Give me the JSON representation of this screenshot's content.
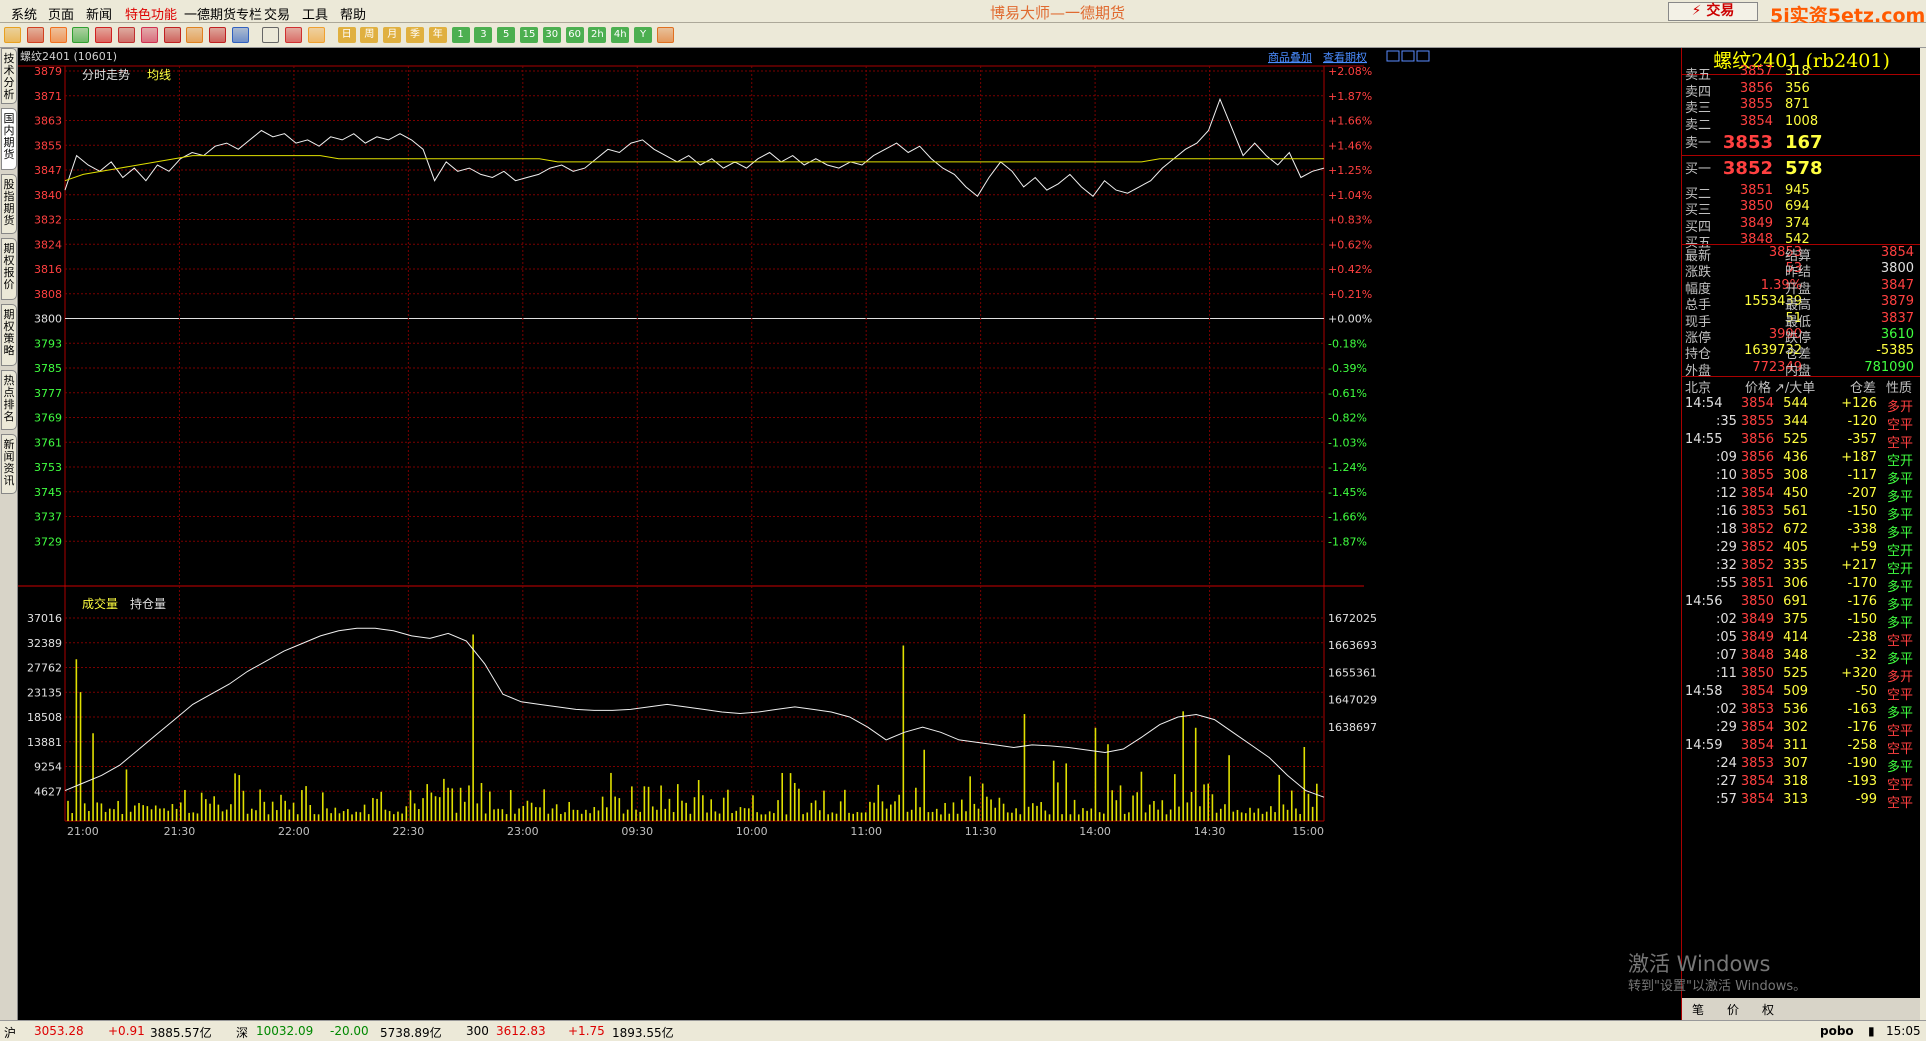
{
  "menu": {
    "items": [
      "系统",
      "页面",
      "新闻",
      "特色功能",
      "一德期货专栏",
      "交易",
      "工具",
      "帮助"
    ],
    "app_title": "博易大师—一德期货",
    "trade_button": "⚡ 交易",
    "watermark": "5i实资5etz.com"
  },
  "toolbar": {
    "buttons": [
      "back",
      "home",
      "f10",
      "refresh",
      "sync",
      "search",
      "zoom",
      "draw",
      "fill",
      "bulb",
      "新",
      "table",
      "trend",
      "dk",
      "日",
      "周",
      "月",
      "季",
      "年",
      "1",
      "3",
      "5",
      "15",
      "30",
      "60",
      "2h",
      "4h",
      "Y",
      "calc"
    ]
  },
  "left_tabs": {
    "items": [
      "技术分析",
      "国内期货",
      "股指期货",
      "期权报价",
      "期权策略",
      "热点排名",
      "新闻资讯"
    ],
    "active": 1
  },
  "chart": {
    "contract_label": "螺纹2401 (10601)",
    "link_overlay": "商品叠加",
    "link_options": "查看期权",
    "legend_price": "分时走势",
    "legend_avg": "均线",
    "legend_vol": "成交量",
    "legend_oi": "持仓量"
  },
  "chart_data": {
    "type": "line",
    "price_axis_left": [
      "3879",
      "3871",
      "3863",
      "3855",
      "3847",
      "3840",
      "3832",
      "3824",
      "3816",
      "3808",
      "3800",
      "3793",
      "3785",
      "3777",
      "3769",
      "3761",
      "3753",
      "3745",
      "3737",
      "3729"
    ],
    "price_axis_right": [
      "+2.08%",
      "+1.87%",
      "+1.66%",
      "+1.46%",
      "+1.25%",
      "+1.04%",
      "+0.83%",
      "+0.62%",
      "+0.42%",
      "+0.21%",
      "+0.00%",
      "-0.18%",
      "-0.39%",
      "-0.61%",
      "-0.82%",
      "-1.03%",
      "-1.24%",
      "-1.45%",
      "-1.66%",
      "-1.87%"
    ],
    "vol_axis_left": [
      "37016",
      "32389",
      "27762",
      "23135",
      "18508",
      "13881",
      "9254",
      "4627"
    ],
    "oi_axis_right": [
      "1672025",
      "1663693",
      "1655361",
      "1647029",
      "1638697"
    ],
    "time_labels": [
      "21:00",
      "21:30",
      "22:00",
      "22:30",
      "23:00",
      "09:30",
      "10:00",
      "11:00",
      "11:30",
      "14:00",
      "14:30",
      "15:00"
    ],
    "price_range": [
      3725,
      3883
    ],
    "base_price": 3800,
    "price_series": [
      3845,
      3856,
      3853,
      3851,
      3854,
      3849,
      3852,
      3848,
      3853,
      3851,
      3855,
      3857,
      3856,
      3859,
      3860,
      3858,
      3861,
      3864,
      3862,
      3863,
      3860,
      3861,
      3859,
      3862,
      3861,
      3863,
      3860,
      3862,
      3861,
      3863,
      3861,
      3858,
      3848,
      3854,
      3851,
      3852,
      3850,
      3849,
      3851,
      3848,
      3849,
      3850,
      3852,
      3853,
      3851,
      3852,
      3855,
      3858,
      3857,
      3860,
      3861,
      3858,
      3856,
      3854,
      3856,
      3853,
      3855,
      3852,
      3854,
      3852,
      3855,
      3857,
      3854,
      3856,
      3853,
      3855,
      3853,
      3852,
      3854,
      3853,
      3856,
      3858,
      3860,
      3857,
      3859,
      3855,
      3852,
      3850,
      3846,
      3843,
      3849,
      3854,
      3851,
      3846,
      3849,
      3845,
      3847,
      3850,
      3846,
      3843,
      3848,
      3845,
      3844,
      3846,
      3848,
      3852,
      3855,
      3858,
      3860,
      3864,
      3874,
      3865,
      3856,
      3860,
      3856,
      3853,
      3857,
      3849,
      3851,
      3852
    ],
    "avg_series": [
      3848,
      3850,
      3851,
      3852,
      3853,
      3854,
      3855,
      3856,
      3856,
      3856,
      3856,
      3856,
      3856,
      3856,
      3856,
      3855,
      3855,
      3855,
      3855,
      3855,
      3855,
      3855,
      3855,
      3855,
      3855,
      3855,
      3855,
      3854,
      3854,
      3854,
      3854,
      3854,
      3854,
      3854,
      3854,
      3854,
      3854,
      3854,
      3854,
      3854,
      3854,
      3854,
      3854,
      3854,
      3854,
      3854,
      3854,
      3854,
      3854,
      3854,
      3854,
      3854,
      3854,
      3854,
      3854,
      3854,
      3854,
      3854,
      3854,
      3854,
      3855,
      3855,
      3855,
      3855,
      3855,
      3855,
      3855,
      3855,
      3855,
      3855
    ],
    "oi_series": [
      1640000,
      1641500,
      1643000,
      1645000,
      1648000,
      1651000,
      1654000,
      1657000,
      1659000,
      1661000,
      1663500,
      1665500,
      1667500,
      1669000,
      1670500,
      1671500,
      1672025,
      1672000,
      1671500,
      1670500,
      1670000,
      1671000,
      1669500,
      1665000,
      1659000,
      1657500,
      1657000,
      1656500,
      1656000,
      1655800,
      1655800,
      1656000,
      1656500,
      1657000,
      1656500,
      1656000,
      1655500,
      1655200,
      1655500,
      1656000,
      1656500,
      1656000,
      1655500,
      1654500,
      1652500,
      1650000,
      1651500,
      1652500,
      1651500,
      1650000,
      1649500,
      1649000,
      1648500,
      1649000,
      1648800,
      1648500,
      1648000,
      1647500,
      1648200,
      1650500,
      1653000,
      1654500,
      1655000,
      1654000,
      1651500,
      1649000,
      1646500,
      1643000,
      1640000,
      1638697
    ],
    "oi_range": [
      1634000,
      1676000
    ],
    "vol_max": 37016,
    "vol_spikes": [
      {
        "i": 2,
        "v": 29500
      },
      {
        "i": 3,
        "v": 23500
      },
      {
        "i": 6,
        "v": 16000
      },
      {
        "i": 97,
        "v": 34000
      },
      {
        "i": 200,
        "v": 32000
      },
      {
        "i": 267,
        "v": 20000
      },
      {
        "i": 236,
        "v": 11000
      },
      {
        "i": 205,
        "v": 13000
      },
      {
        "i": 239,
        "v": 10500
      },
      {
        "i": 229,
        "v": 19500
      },
      {
        "i": 246,
        "v": 17000
      },
      {
        "i": 249,
        "v": 14000
      },
      {
        "i": 270,
        "v": 17000
      },
      {
        "i": 278,
        "v": 12000
      },
      {
        "i": 296,
        "v": 13500
      }
    ]
  },
  "quote": {
    "title": "螺纹2401 (rb2401)",
    "asks": [
      {
        "label": "卖五",
        "price": "3857",
        "vol": "318"
      },
      {
        "label": "卖四",
        "price": "3856",
        "vol": "356"
      },
      {
        "label": "卖三",
        "price": "3855",
        "vol": "871"
      },
      {
        "label": "卖二",
        "price": "3854",
        "vol": "1008"
      },
      {
        "label": "卖一",
        "price": "3853",
        "vol": "167"
      }
    ],
    "bids": [
      {
        "label": "买一",
        "price": "3852",
        "vol": "578"
      },
      {
        "label": "买二",
        "price": "3851",
        "vol": "945"
      },
      {
        "label": "买三",
        "price": "3850",
        "vol": "694"
      },
      {
        "label": "买四",
        "price": "3849",
        "vol": "374"
      },
      {
        "label": "买五",
        "price": "3848",
        "vol": "542"
      }
    ],
    "stats": [
      {
        "l1": "最新",
        "v1": "3853",
        "c1": "red",
        "l2": "结算",
        "v2": "3854",
        "c2": "red"
      },
      {
        "l1": "涨跌",
        "v1": "53",
        "c1": "red",
        "l2": "昨结",
        "v2": "3800",
        "c2": "wht"
      },
      {
        "l1": "幅度",
        "v1": "1.39%",
        "c1": "red",
        "l2": "开盘",
        "v2": "3847",
        "c2": "red"
      },
      {
        "l1": "总手",
        "v1": "1553439",
        "c1": "yel",
        "l2": "最高",
        "v2": "3879",
        "c2": "red"
      },
      {
        "l1": "现手",
        "v1": "51",
        "c1": "yel",
        "l2": "最低",
        "v2": "3837",
        "c2": "red"
      },
      {
        "l1": "涨停",
        "v1": "3990",
        "c1": "red",
        "l2": "跌停",
        "v2": "3610",
        "c2": "grn"
      },
      {
        "l1": "持仓",
        "v1": "1639732",
        "c1": "yel",
        "l2": "仓差",
        "v2": "-5385",
        "c2": "yel"
      },
      {
        "l1": "外盘",
        "v1": "772349",
        "c1": "red",
        "l2": "内盘",
        "v2": "781090",
        "c2": "grn"
      }
    ],
    "ticks_header": {
      "time": "北京",
      "price": "价格",
      "vol": "↗/大单",
      "diff": "仓差",
      "nature": "性质"
    },
    "ticks": [
      {
        "t": "14:54",
        "big": true,
        "p": "3854",
        "v": "544",
        "d": "+126",
        "n": "多开",
        "nc": "red"
      },
      {
        "t": ":35",
        "big": false,
        "p": "3855",
        "v": "344",
        "d": "-120",
        "n": "空平",
        "nc": "red"
      },
      {
        "t": "14:55",
        "big": true,
        "p": "3856",
        "v": "525",
        "d": "-357",
        "n": "空平",
        "nc": "red"
      },
      {
        "t": ":09",
        "big": false,
        "p": "3856",
        "v": "436",
        "d": "+187",
        "n": "空开",
        "nc": "grn"
      },
      {
        "t": ":10",
        "big": false,
        "p": "3855",
        "v": "308",
        "d": "-117",
        "n": "多平",
        "nc": "grn"
      },
      {
        "t": ":12",
        "big": false,
        "p": "3854",
        "v": "450",
        "d": "-207",
        "n": "多平",
        "nc": "grn"
      },
      {
        "t": ":16",
        "big": false,
        "p": "3853",
        "v": "561",
        "d": "-150",
        "n": "多平",
        "nc": "grn"
      },
      {
        "t": ":18",
        "big": false,
        "p": "3852",
        "v": "672",
        "d": "-338",
        "n": "多平",
        "nc": "grn"
      },
      {
        "t": ":29",
        "big": false,
        "p": "3852",
        "v": "405",
        "d": "+59",
        "n": "空开",
        "nc": "grn"
      },
      {
        "t": ":32",
        "big": false,
        "p": "3852",
        "v": "335",
        "d": "+217",
        "n": "空开",
        "nc": "grn"
      },
      {
        "t": ":55",
        "big": false,
        "p": "3851",
        "v": "306",
        "d": "-170",
        "n": "多平",
        "nc": "grn"
      },
      {
        "t": "14:56",
        "big": true,
        "p": "3850",
        "v": "691",
        "d": "-176",
        "n": "多平",
        "nc": "grn"
      },
      {
        "t": ":02",
        "big": false,
        "p": "3849",
        "v": "375",
        "d": "-150",
        "n": "多平",
        "nc": "grn"
      },
      {
        "t": ":05",
        "big": false,
        "p": "3849",
        "v": "414",
        "d": "-238",
        "n": "空平",
        "nc": "red"
      },
      {
        "t": ":07",
        "big": false,
        "p": "3848",
        "v": "348",
        "d": "-32",
        "n": "多平",
        "nc": "grn"
      },
      {
        "t": ":11",
        "big": false,
        "p": "3850",
        "v": "525",
        "d": "+320",
        "n": "多开",
        "nc": "red"
      },
      {
        "t": "14:58",
        "big": true,
        "p": "3854",
        "v": "509",
        "d": "-50",
        "n": "空平",
        "nc": "red"
      },
      {
        "t": ":02",
        "big": false,
        "p": "3853",
        "v": "536",
        "d": "-163",
        "n": "多平",
        "nc": "grn"
      },
      {
        "t": ":29",
        "big": false,
        "p": "3854",
        "v": "302",
        "d": "-176",
        "n": "空平",
        "nc": "red"
      },
      {
        "t": "14:59",
        "big": true,
        "p": "3854",
        "v": "311",
        "d": "-258",
        "n": "空平",
        "nc": "red"
      },
      {
        "t": ":24",
        "big": false,
        "p": "3853",
        "v": "307",
        "d": "-190",
        "n": "多平",
        "nc": "grn"
      },
      {
        "t": ":27",
        "big": false,
        "p": "3854",
        "v": "318",
        "d": "-193",
        "n": "空平",
        "nc": "red"
      },
      {
        "t": ":57",
        "big": false,
        "p": "3854",
        "v": "313",
        "d": "-99",
        "n": "空平",
        "nc": "red"
      }
    ],
    "bottom_tabs": [
      "笔",
      "价",
      "权"
    ]
  },
  "activation": {
    "line1": "激活 Windows",
    "line2": "转到\"设置\"以激活 Windows。"
  },
  "status": {
    "sh_label": "沪",
    "sh_value": "3053.28",
    "sh_change": "+0.91",
    "sh_amount": "3885.57亿",
    "sz_label": "深",
    "sz_value": "10032.09",
    "sz_change": "-20.00",
    "sz_amount": "5738.89亿",
    "hs_label": "300",
    "hs_value": "3612.83",
    "hs_change": "+1.75",
    "hs_amount": "1893.55亿",
    "brand": "pobo",
    "clock": "15:05"
  }
}
